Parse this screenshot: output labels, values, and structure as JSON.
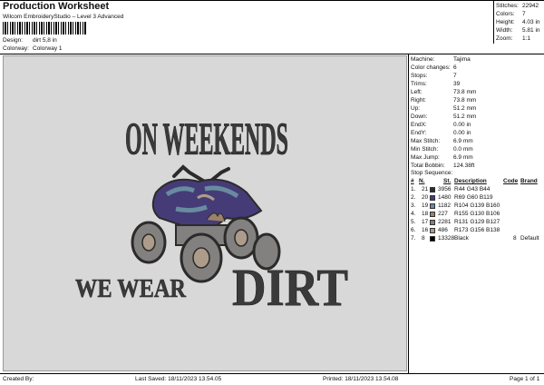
{
  "header": {
    "title": "Production Worksheet",
    "subtitle": "Wilcom EmbroideryStudio – Level 3 Advanced",
    "design_label": "Design:",
    "design_value": "dirt 5,8 in",
    "colorway_label": "Colorway:",
    "colorway_value": "Colorway 1"
  },
  "stats": [
    {
      "label": "Stitches:",
      "value": "22942"
    },
    {
      "label": "Colors:",
      "value": "7"
    },
    {
      "label": "Height:",
      "value": "4.03 in"
    },
    {
      "label": "Width:",
      "value": "5.81 in"
    },
    {
      "label": "Zoom:",
      "value": "1:1"
    }
  ],
  "design": {
    "line1": "ON WEEKENDS",
    "line2": "WE WEAR",
    "line3": "DIRT"
  },
  "machine_info": [
    {
      "label": "Machine:",
      "value": "Tajima"
    },
    {
      "label": "Color changes:",
      "value": "6"
    },
    {
      "label": "Stops:",
      "value": "7"
    },
    {
      "label": "Trims:",
      "value": "39"
    },
    {
      "label": "Left:",
      "value": "73.8 mm"
    },
    {
      "label": "Right:",
      "value": "73.8 mm"
    },
    {
      "label": "Up:",
      "value": "51.2 mm"
    },
    {
      "label": "Down:",
      "value": "51.2 mm"
    },
    {
      "label": "EndX:",
      "value": "0.00 in"
    },
    {
      "label": "EndY:",
      "value": "0.00 in"
    },
    {
      "label": "Max Stitch:",
      "value": "6.9 mm"
    },
    {
      "label": "Min Stitch:",
      "value": "0.0 mm"
    },
    {
      "label": "Max Jump:",
      "value": "6.9 mm"
    },
    {
      "label": "Total Bobbin:",
      "value": "124.38ft"
    }
  ],
  "stop_sequence": {
    "title": "Stop Sequence:",
    "headers": {
      "hash": "#",
      "n": "N.",
      "st": "St.",
      "description": "Description",
      "code": "Code",
      "brand": "Brand"
    },
    "rows": [
      {
        "idx": "1.",
        "n": "21",
        "color": "#2c2b2c",
        "st": "3956",
        "description": "R44 G43 B44",
        "code": "",
        "brand": ""
      },
      {
        "idx": "2.",
        "n": "20",
        "color": "#453c77",
        "st": "1480",
        "description": "R69 G60 B119",
        "code": "",
        "brand": ""
      },
      {
        "idx": "3.",
        "n": "19",
        "color": "#688ba0",
        "st": "1182",
        "description": "R104 G139 B160",
        "code": "",
        "brand": ""
      },
      {
        "idx": "4.",
        "n": "18",
        "color": "#9b826a",
        "st": "227",
        "description": "R155 G130 B106",
        "code": "",
        "brand": ""
      },
      {
        "idx": "5.",
        "n": "17",
        "color": "#83817f",
        "st": "2281",
        "description": "R131 G129 B127",
        "code": "",
        "brand": ""
      },
      {
        "idx": "6.",
        "n": "16",
        "color": "#ad9c8a",
        "st": "486",
        "description": "R173 G156 B138",
        "code": "",
        "brand": ""
      },
      {
        "idx": "7.",
        "n": "8",
        "color": "#000000",
        "st": "13328",
        "description": "Black",
        "code": "8",
        "brand": "Default"
      }
    ]
  },
  "footer": {
    "created_by": "Created By:",
    "last_saved": "Last Saved: 18/11/2023 13.54.05",
    "printed": "Printed: 18/11/2023 13.54.08",
    "page": "Page 1 of 1"
  }
}
